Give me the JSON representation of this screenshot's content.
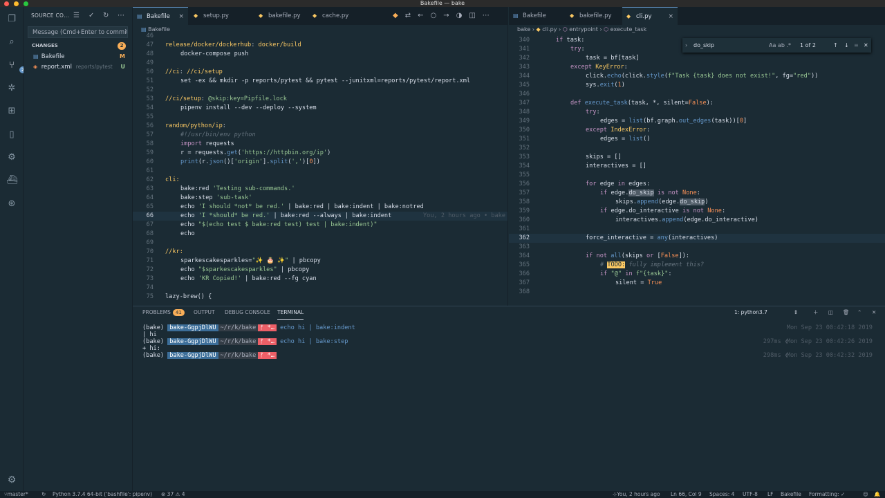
{
  "window": {
    "title": "Bakefile — bake"
  },
  "activity": {
    "scm_badge": "2"
  },
  "sidebar": {
    "header": "SOURCE CO…",
    "message_placeholder": "Message (Cmd+Enter to commit",
    "changes_label": "CHANGES",
    "changes_count": "2",
    "files": [
      {
        "name": "Bakefile",
        "path": "",
        "status": "M"
      },
      {
        "name": "report.xml",
        "path": "reports/pytest",
        "status": "U"
      }
    ]
  },
  "left_editor": {
    "tabs": [
      {
        "label": "Bakefile",
        "closable": "×"
      },
      {
        "label": "setup.py"
      },
      {
        "label": "bakefile.py"
      },
      {
        "label": "cache.py"
      }
    ],
    "breadcrumb": "Bakefile",
    "blame": "You, 2 hours ago • bake"
  },
  "right_editor": {
    "tabs": [
      {
        "label": "Bakefile"
      },
      {
        "label": "bakefile.py"
      },
      {
        "label": "cli.py",
        "closable": "×"
      }
    ],
    "breadcrumb": [
      "bake",
      "cli.py",
      "entrypoint",
      "execute_task"
    ],
    "find": {
      "query": "do_skip",
      "opts": "Aa  ab  .*",
      "count": "1 of 2"
    }
  },
  "panel": {
    "tabs": [
      "PROBLEMS",
      "OUTPUT",
      "DEBUG CONSOLE",
      "TERMINAL"
    ],
    "problems_count": "41",
    "terminal_select": "1: python3.7",
    "terminal": [
      {
        "env": "(bake)",
        "host": "bake-GgpjDlWU",
        "path": "~/r/k/bake",
        "git": "ᚠ *…",
        "cmd": "echo hi | bake:indent",
        "time": "Mon Sep 23 00:42:18 2019",
        "dur": ""
      },
      {
        "output": " | hi"
      },
      {
        "env": "(bake)",
        "host": "bake-GgpjDlWU",
        "path": "~/r/k/bake",
        "git": "ᚠ *…",
        "cmd": "echo hi | bake:step",
        "time": "Mon Sep 23 00:42:26 2019",
        "dur": "297ms ❮"
      },
      {
        "output": " + hi:"
      },
      {
        "env": "(bake)",
        "host": "bake-GgpjDlWU",
        "path": "~/r/k/bake",
        "git": "ᚠ *…",
        "cmd": "",
        "time": "Mon Sep 23 00:42:32 2019",
        "dur": "298ms ❮"
      }
    ]
  },
  "status": {
    "branch": "master*",
    "python": "Python 3.7.4 64-bit ('bashfile': pipenv)",
    "problems": "⊗ 37 ⚠ 4",
    "blame": "You, 2 hours ago",
    "position": "Ln 66, Col 9",
    "spaces": "Spaces: 4",
    "encoding": "UTF-8",
    "eol": "LF",
    "language": "Bakefile",
    "formatting": "Formatting: ✓"
  },
  "colors": {
    "accent": "#6699cc",
    "bg": "#1b2b34",
    "red": "#ec5f67",
    "orange": "#f99157",
    "green": "#99c794"
  }
}
